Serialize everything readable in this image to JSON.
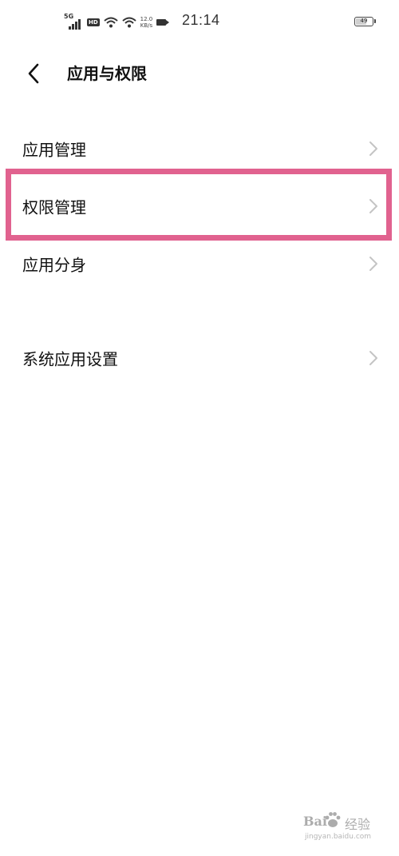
{
  "status_bar": {
    "network_type": "5G",
    "hd_badge": "HD",
    "speed_value": "12.0",
    "speed_unit": "KB/s",
    "time": "21:14",
    "battery_percent": "49",
    "icons": [
      "signal-icon",
      "hd-icon",
      "wifi-icon",
      "wifi-icon",
      "camera-icon",
      "battery-icon"
    ]
  },
  "header": {
    "back_icon": "chevron-left-icon",
    "title": "应用与权限"
  },
  "menu": {
    "items": [
      {
        "label": "应用管理",
        "icon": "chevron-right-icon"
      },
      {
        "label": "权限管理",
        "icon": "chevron-right-icon",
        "highlighted": true
      },
      {
        "label": "应用分身",
        "icon": "chevron-right-icon"
      },
      {
        "label": "系统应用设置",
        "icon": "chevron-right-icon"
      }
    ]
  },
  "annotation": {
    "highlight_color": "#e1628f"
  },
  "watermark": {
    "brand": "Bai",
    "chinese": "经验",
    "url": "jingyan.baidu.com"
  }
}
